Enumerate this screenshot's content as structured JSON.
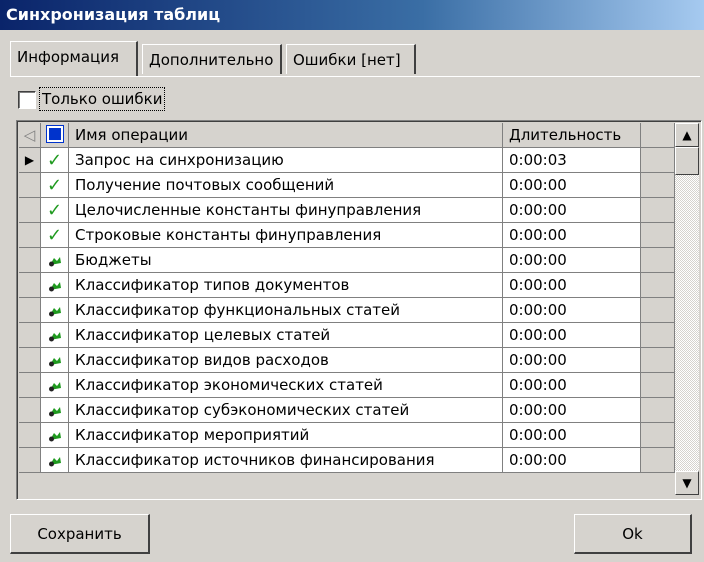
{
  "window": {
    "title": "Синхронизация таблиц"
  },
  "tabs": [
    {
      "label": "Информация",
      "active": true
    },
    {
      "label": "Дополнительно",
      "active": false
    },
    {
      "label": "Ошибки [нет]",
      "active": false
    }
  ],
  "filter": {
    "label": "Только ошибки",
    "checked": false
  },
  "grid": {
    "columns": {
      "name": "Имя операции",
      "duration": "Длительность"
    },
    "rows": [
      {
        "name": "Запрос на синхронизацию",
        "duration": "0:00:03",
        "status": "check-icon",
        "current": true
      },
      {
        "name": "Получение почтовых сообщений",
        "duration": "0:00:00",
        "status": "check-icon"
      },
      {
        "name": "Целочисленные константы финуправления",
        "duration": "0:00:00",
        "status": "check-icon"
      },
      {
        "name": "Строковые константы финуправления",
        "duration": "0:00:00",
        "status": "check-icon"
      },
      {
        "name": "Бюджеты",
        "duration": "0:00:00",
        "status": "sync-icon"
      },
      {
        "name": "Классификатор типов документов",
        "duration": "0:00:00",
        "status": "sync-icon"
      },
      {
        "name": "Классификатор функциональных статей",
        "duration": "0:00:00",
        "status": "sync-icon"
      },
      {
        "name": "Классификатор целевых статей",
        "duration": "0:00:00",
        "status": "sync-icon"
      },
      {
        "name": "Классификатор видов расходов",
        "duration": "0:00:00",
        "status": "sync-icon"
      },
      {
        "name": "Классификатор экономических статей",
        "duration": "0:00:00",
        "status": "sync-icon"
      },
      {
        "name": "Классификатор субэкономических статей",
        "duration": "0:00:00",
        "status": "sync-icon"
      },
      {
        "name": "Классификатор мероприятий",
        "duration": "0:00:00",
        "status": "sync-icon"
      },
      {
        "name": "Классификатор источников финансирования",
        "duration": "0:00:00",
        "status": "sync-icon"
      }
    ]
  },
  "buttons": {
    "save": "Сохранить",
    "ok": "Ok"
  },
  "colors": {
    "title_bar": "#0a246a",
    "check": "#1f9a1f",
    "sync": "#1f9a1f",
    "window": "#d6d3ce"
  }
}
